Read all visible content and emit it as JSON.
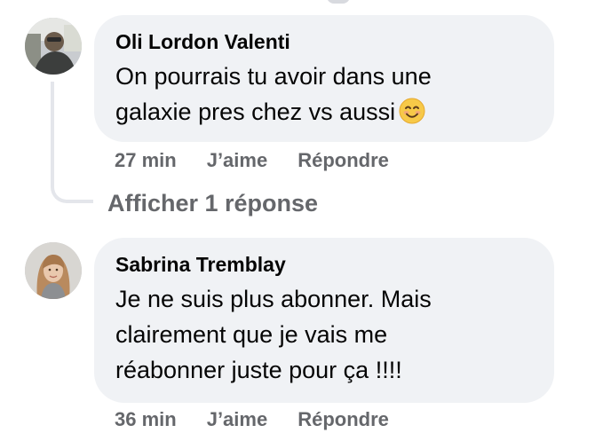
{
  "comments": [
    {
      "author": "Oli Lordon Valenti",
      "lines": [
        "On pourrais tu avoir dans une",
        "galaxie pres chez vs aussi"
      ],
      "emoji": "smiling-face-emoji",
      "time": "27 min",
      "like_label": "J’aime",
      "reply_label": "Répondre",
      "avatar_icon": "profile-photo-man"
    },
    {
      "author": "Sabrina Tremblay",
      "lines": [
        "Je ne suis plus abonner. Mais",
        "clairement que je vais me",
        "réabonner juste pour ça !!!!"
      ],
      "time": "36 min",
      "like_label": "J’aime",
      "reply_label": "Répondre",
      "avatar_icon": "profile-photo-woman"
    }
  ],
  "thread": {
    "show_replies_label": "Afficher 1 réponse"
  },
  "colors": {
    "bubble": "#f0f2f5",
    "text": "#050505",
    "secondary": "#65676b",
    "thread_line": "#e4e6eb"
  }
}
